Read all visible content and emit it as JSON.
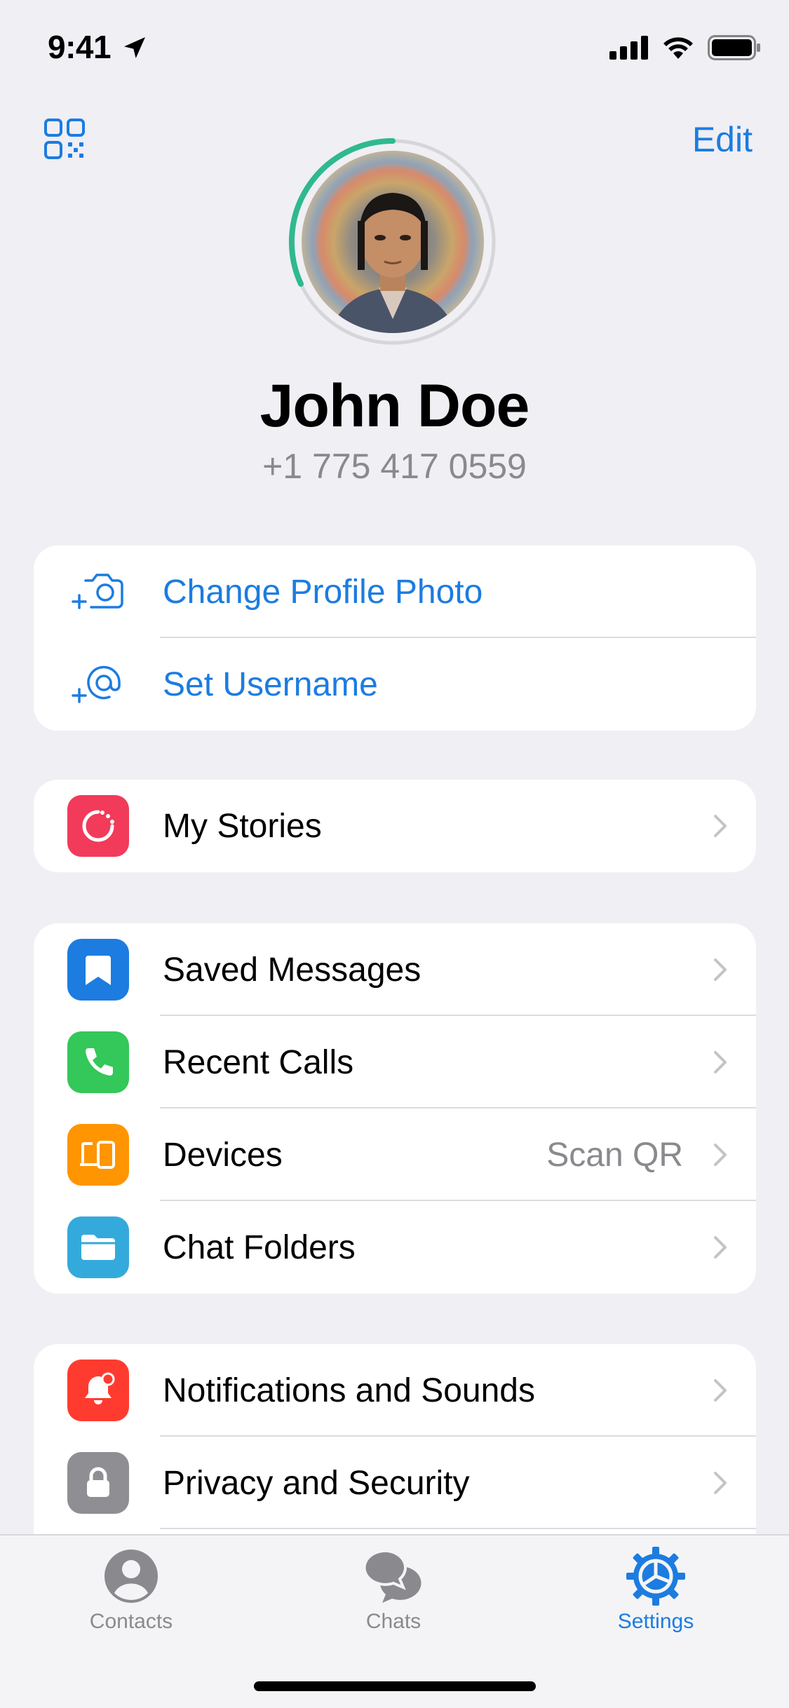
{
  "status_bar": {
    "time": "9:41"
  },
  "header": {
    "edit_label": "Edit"
  },
  "profile": {
    "name": "John Doe",
    "phone": "+1 775 417 0559"
  },
  "account_actions": [
    {
      "label": "Change Profile Photo",
      "icon": "camera-add-icon"
    },
    {
      "label": "Set Username",
      "icon": "at-sign-add-icon"
    }
  ],
  "stories": {
    "label": "My Stories",
    "icon": "stories-icon",
    "color": "#F23A5A"
  },
  "main_items": [
    {
      "label": "Saved Messages",
      "icon": "bookmark-icon",
      "color": "#1C7CE0"
    },
    {
      "label": "Recent Calls",
      "icon": "phone-icon",
      "color": "#34C759"
    },
    {
      "label": "Devices",
      "icon": "devices-icon",
      "color": "#FF9500",
      "detail": "Scan QR"
    },
    {
      "label": "Chat Folders",
      "icon": "folder-icon",
      "color": "#34AADC"
    }
  ],
  "settings_items": [
    {
      "label": "Notifications and Sounds",
      "icon": "bell-icon",
      "color": "#FF3B30"
    },
    {
      "label": "Privacy and Security",
      "icon": "lock-icon",
      "color": "#8E8E93"
    }
  ],
  "tab_bar": {
    "contacts": "Contacts",
    "chats": "Chats",
    "settings": "Settings"
  },
  "colors": {
    "accent": "#1C7CE0",
    "background": "#EFEFF4"
  }
}
